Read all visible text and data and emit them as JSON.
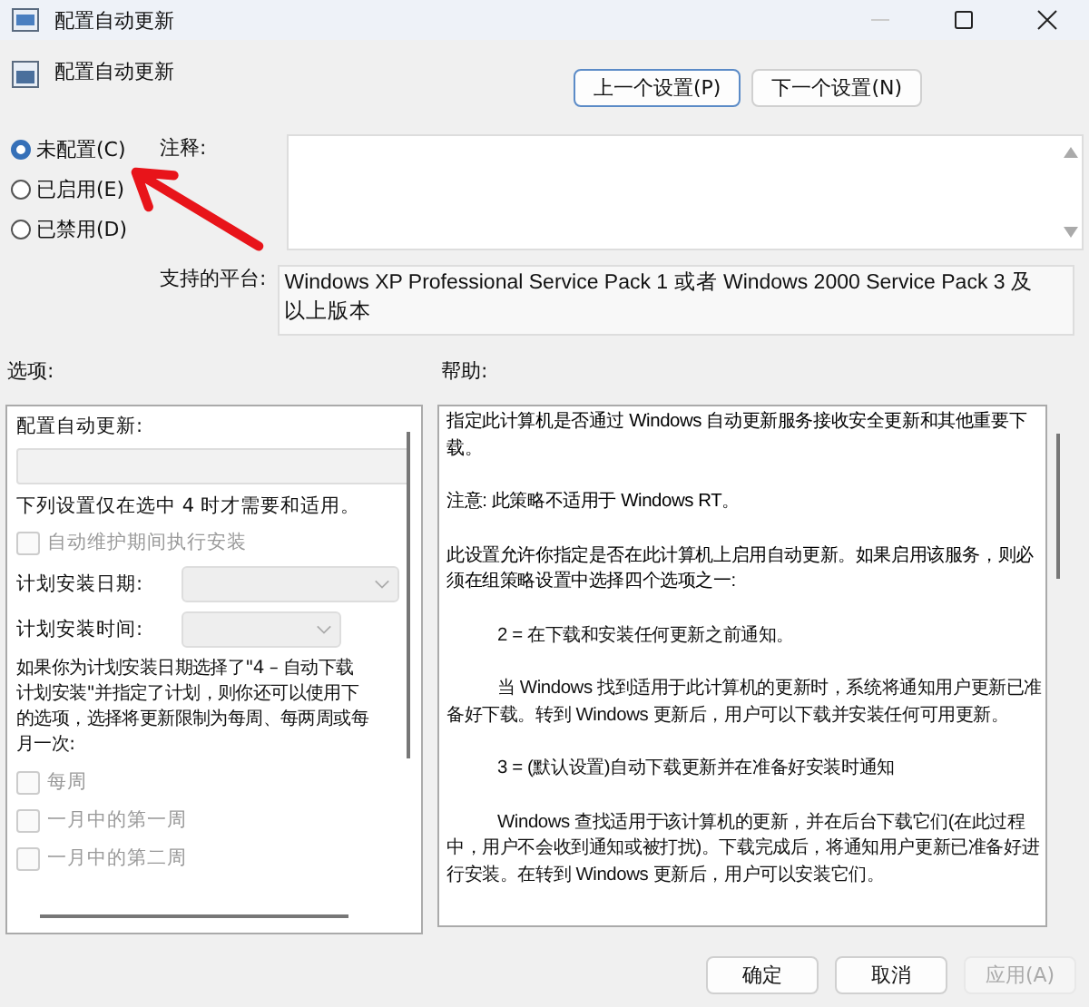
{
  "window": {
    "title": "配置自动更新"
  },
  "header": {
    "title": "配置自动更新"
  },
  "nav_buttons": [
    {
      "label": "上一个设置(P)",
      "selected": true
    },
    {
      "label": "下一个设置(N)",
      "selected": false
    }
  ],
  "state_options": [
    {
      "label": "未配置(C)",
      "selected": true
    },
    {
      "label": "已启用(E)",
      "selected": false
    },
    {
      "label": "已禁用(D)",
      "selected": false
    }
  ],
  "comment": {
    "label": "注释:"
  },
  "platform": {
    "label": "支持的平台:",
    "value": "Windows XP Professional Service Pack 1 或者 Windows 2000 Service Pack 3 及以上版本"
  },
  "options": {
    "label": "选项:",
    "items": [
      {
        "kind": "heading",
        "text": "配置自动更新:"
      },
      {
        "kind": "dropdown",
        "disabled": true
      },
      {
        "kind": "text",
        "text": "下列设置仅在选中 4 时才需要和适用。"
      },
      {
        "kind": "checkbox",
        "text": "自动维护期间执行安装",
        "checked": false,
        "disabled": true
      },
      {
        "kind": "select",
        "text": "计划安装日期:",
        "disabled": true
      },
      {
        "kind": "select_small",
        "text": "计划安装时间:",
        "disabled": true
      },
      {
        "kind": "paragraph",
        "lines": [
          "如果你为计划安装日期选择了\"4 – 自动下载",
          "计划安装\"并指定了计划，则你还可以使用下",
          "的选项，选择将更新限制为每周、每两周或每",
          "月一次:"
        ]
      },
      {
        "kind": "checkbox",
        "text": "每周",
        "checked": false,
        "disabled": true
      },
      {
        "kind": "checkbox",
        "text": "一月中的第一周",
        "checked": false,
        "disabled": true
      },
      {
        "kind": "checkbox",
        "text": "一月中的第二周",
        "checked": false,
        "disabled": true
      }
    ]
  },
  "help": {
    "label": "帮助:",
    "paragraphs": [
      {
        "text": "指定此计算机是否通过 Windows 自动更新服务接收安全更新和其他重要下载。",
        "indent": false
      },
      {
        "text": "注意: 此策略不适用于 Windows RT。",
        "indent": false
      },
      {
        "text": "此设置允许你指定是否在此计算机上启用自动更新。如果启用该服务，则必须在组策略设置中选择四个选项之一:",
        "indent": false
      },
      {
        "text": "2 = 在下载和安装任何更新之前通知。",
        "indent": true
      },
      {
        "text": "当 Windows 找到适用于此计算机的更新时，系统将通知用户更新已准备好下载。转到 Windows 更新后，用户可以下载并安装任何可用更新。",
        "indent": true
      },
      {
        "text": "3 = (默认设置)自动下载更新并在准备好安装时通知",
        "indent": true
      },
      {
        "text": "Windows 查找适用于该计算机的更新，并在后台下载它们(在此过程中，用户不会收到通知或被打扰)。下载完成后，将通知用户更新已准备好进行安装。在转到 Windows 更新后，用户可以安装它们。",
        "indent": true
      }
    ]
  },
  "footer_buttons": [
    {
      "label": "确定",
      "disabled": false
    },
    {
      "label": "取消",
      "disabled": false
    },
    {
      "label": "应用(A)",
      "disabled": true
    }
  ]
}
